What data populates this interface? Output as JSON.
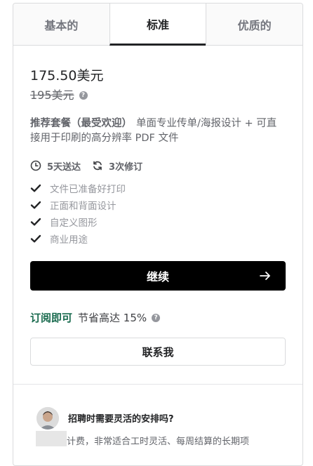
{
  "tabs": [
    {
      "label": "基本的"
    },
    {
      "label": "标准"
    },
    {
      "label": "优质的"
    }
  ],
  "package": {
    "price": "175.50美元",
    "original_price": "195美元",
    "title": "推荐套餐（最受欢迎）",
    "description": "单面专业传单/海报设计 + 可直接用于印刷的高分辨率 PDF 文件",
    "delivery": "5天送达",
    "revisions": "3次修订",
    "features": [
      "文件已准备好打印",
      "正面和背面设计",
      "自定义图形",
      "商业用途"
    ],
    "continue_label": "继续"
  },
  "subscription": {
    "link_label": "订阅即可",
    "text": "节省高达 15%"
  },
  "contact_label": "联系我",
  "hire": {
    "title": "招聘时需要灵活的安排吗?",
    "text": "计费，非常适合工时灵活、每周结算的长期项"
  },
  "colors": {
    "accent_green": "#1a6b4f",
    "button_black": "#000000",
    "check_dark": "#222325",
    "muted_text": "#95979d"
  },
  "icons": [
    "question-icon",
    "clock-icon",
    "refresh-icon",
    "check-icon",
    "arrow-right-icon"
  ]
}
